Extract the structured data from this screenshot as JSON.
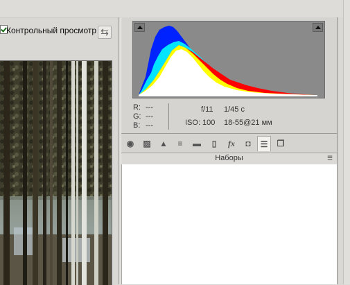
{
  "toolbar": {
    "preview_label": "Контрольный просмотр",
    "preview_checked": true,
    "swap_icon": "swap-arrows-icon"
  },
  "info": {
    "r_label": "R:",
    "r_value": "---",
    "g_label": "G:",
    "g_value": "---",
    "b_label": "B:",
    "b_value": "---",
    "aperture": "f/11",
    "shutter": "1/45 с",
    "iso": "ISO: 100",
    "lens": "18-55@21 мм"
  },
  "histogram": {
    "background": "#8a8a8a",
    "colors": [
      "#ffffff",
      "#00e5ff",
      "#0022ff",
      "#ffff00",
      "#ff0000"
    ]
  },
  "tools": [
    {
      "name": "basic-tool-icon",
      "glyph": "◉"
    },
    {
      "name": "tone-curve-tool-icon",
      "glyph": "▨"
    },
    {
      "name": "detail-tool-icon",
      "glyph": "▲"
    },
    {
      "name": "hsl-tool-icon",
      "glyph": "≡"
    },
    {
      "name": "split-toning-tool-icon",
      "glyph": "▬"
    },
    {
      "name": "lens-corrections-tool-icon",
      "glyph": "▯"
    },
    {
      "name": "effects-tool-icon",
      "glyph": "fx"
    },
    {
      "name": "camera-calibration-tool-icon",
      "glyph": "◘"
    },
    {
      "name": "presets-tool-icon",
      "glyph": "☰"
    },
    {
      "name": "snapshots-tool-icon",
      "glyph": "❐"
    }
  ],
  "presets": {
    "title": "Наборы",
    "menu_icon": "panel-menu-icon"
  }
}
